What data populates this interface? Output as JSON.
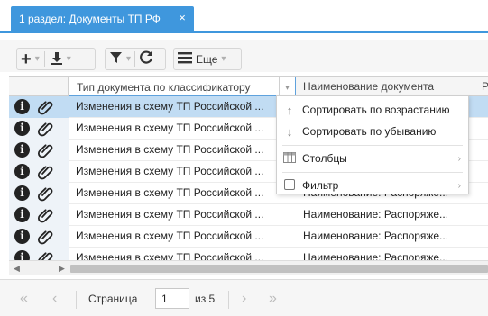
{
  "tab": {
    "title": "1 раздел: Документы ТП РФ",
    "close": "×"
  },
  "toolbar": {
    "more_label": "Еще"
  },
  "grid": {
    "columns": [
      "Тип документа по классификатору",
      "Наименование документа",
      "Р"
    ],
    "rows": [
      {
        "type": "Изменения в схему ТП Российской ...",
        "name": ""
      },
      {
        "type": "Изменения в схему ТП Российской ...",
        "name": ""
      },
      {
        "type": "Изменения в схему ТП Российской ...",
        "name": ""
      },
      {
        "type": "Изменения в схему ТП Российской ...",
        "name": ""
      },
      {
        "type": "Изменения в схему ТП Российской ...",
        "name": "Наименование: Распоряже..."
      },
      {
        "type": "Изменения в схему ТП Российской ...",
        "name": "Наименование: Распоряже..."
      },
      {
        "type": "Изменения в схему ТП Российской ...",
        "name": "Наименование: Распоряже..."
      },
      {
        "type": "Изменения в схему ТП Российской ...",
        "name": "Наименование: Распоряже..."
      }
    ],
    "selected_row": 0
  },
  "menu": {
    "sort_asc": "Сортировать по возрастанию",
    "sort_desc": "Сортировать по убыванию",
    "columns": "Столбцы",
    "filter": "Фильтр"
  },
  "pager": {
    "page_label": "Страница",
    "page_value": "1",
    "of_label": "из 5"
  },
  "colors": {
    "accent": "#3f97dd",
    "selected_row": "#c1dcf3"
  }
}
